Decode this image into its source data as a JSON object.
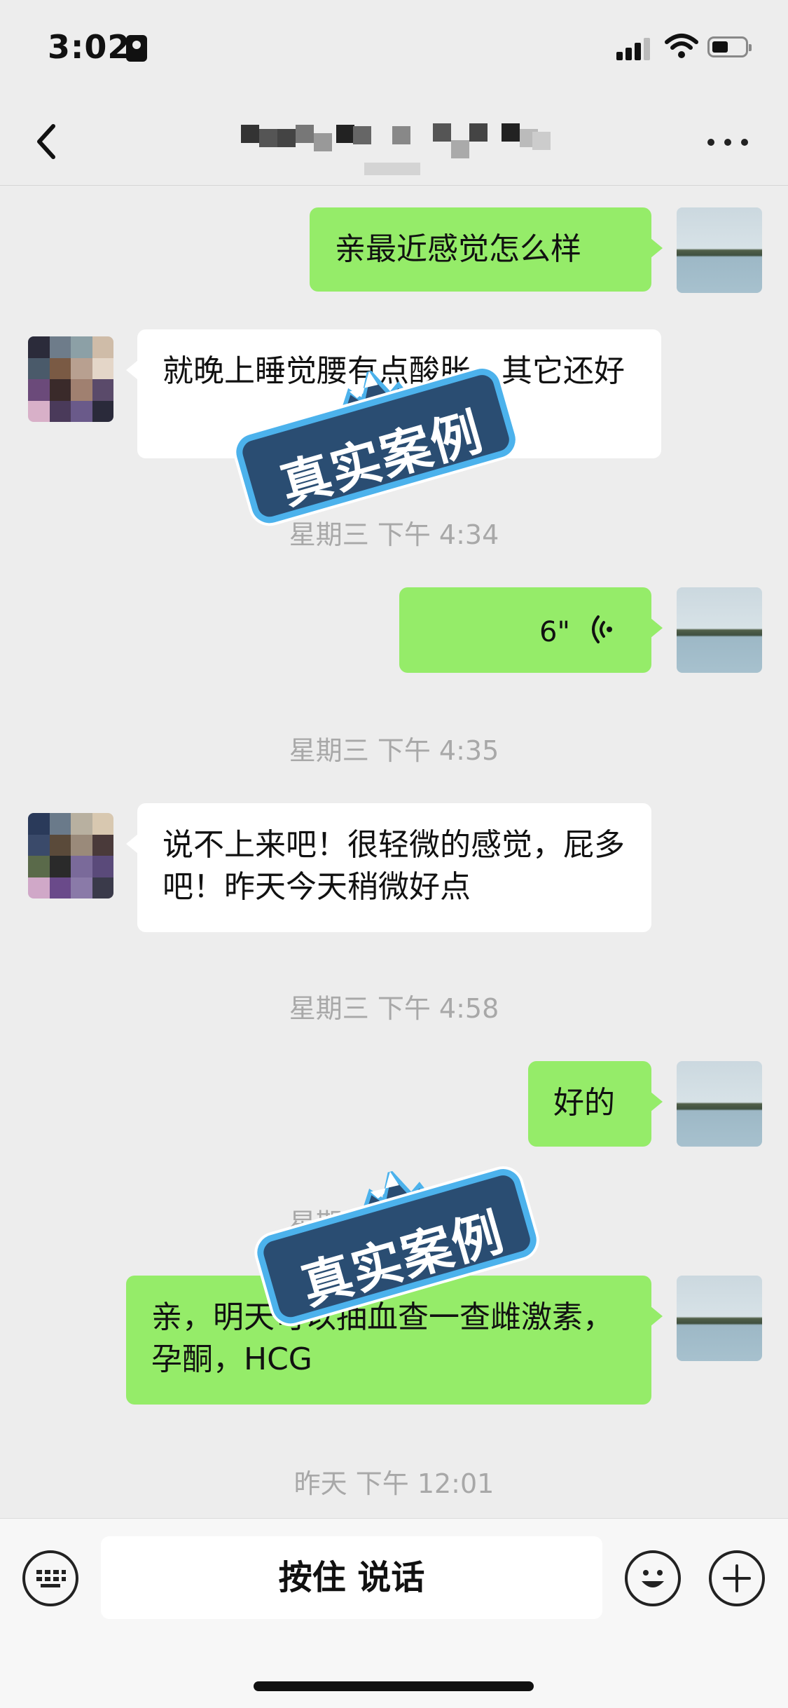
{
  "status_bar": {
    "time": "3:02"
  },
  "header": {
    "title": "",
    "more_icon": "more-icon",
    "back_icon": "back-chevron-icon"
  },
  "messages": [
    {
      "side": "me",
      "type": "text",
      "text": "亲最近感觉怎么样"
    },
    {
      "side": "other",
      "type": "text",
      "text": "就晚上睡觉腰有点酸胀，其它还好"
    },
    {
      "type": "timestamp",
      "text": "星期三 下午 4:34"
    },
    {
      "side": "me",
      "type": "voice",
      "duration": "6\""
    },
    {
      "type": "timestamp",
      "text": "星期三 下午 4:35"
    },
    {
      "side": "other",
      "type": "text",
      "text": "说不上来吧！很轻微的感觉，屁多吧！昨天今天稍微好点"
    },
    {
      "type": "timestamp",
      "text": "星期三 下午 4:58"
    },
    {
      "side": "me",
      "type": "text",
      "text": "好的"
    },
    {
      "type": "timestamp",
      "text": "星期三 下午 4:56"
    },
    {
      "side": "me",
      "type": "text",
      "text": "亲，明天可以抽血查一查雌激素，孕酮，HCG"
    },
    {
      "type": "timestamp",
      "text": "昨天 下午 12:01"
    }
  ],
  "watermark": {
    "text": "真实案例"
  },
  "input_bar": {
    "talk_label": "按住 说话",
    "keyboard_icon": "keyboard-icon",
    "emoji_icon": "emoji-icon",
    "plus_icon": "plus-icon"
  },
  "colors": {
    "my_bubble": "#95ec69",
    "other_bubble": "#ffffff",
    "background": "#ededed",
    "stamp_fill": "#2a4d72",
    "stamp_border": "#4cb2ec"
  }
}
